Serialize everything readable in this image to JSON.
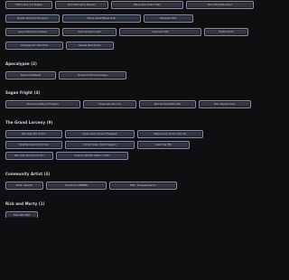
{
  "top_chips": [
    [
      "Ethnic Lina, Ara Rugiwe",
      "Nine Diad Ayme Pasuder",
      "Blauw Vaw Urabor Wlaa",
      "Moe Ahtia Ballo Glanl"
    ],
    [
      "Ppadan Wenavrd Pomapeer",
      "Wpow Cewat Bajeel Kmbr",
      "Blauzzsal Dvbr"
    ],
    [
      "Leonor Bea Rodri Lanbwa",
      "Auna Lanbwei Lvabll",
      "Kaxe Gerd Pelt",
      "Fiwstin Pmstr"
    ],
    [
      "Porbergoneh L Bord Pne",
      "Bebssa Beua Dmbu"
    ]
  ],
  "sections": [
    {
      "title": "Apocalypse (2)",
      "rows": [
        [
          "Djerved Kobbbeet",
          "Fyneprovt Dmmaa Haslgen"
        ]
      ]
    },
    {
      "title": "Sagan Fright (4)",
      "rows": [
        [
          "Sbaral Goerwtts (Q Hosgem)",
          "Fanee-vesn Binn (1)",
          "Wennet Pere BAVA Sd0)",
          "Bierr Nvereb Chern"
        ]
      ]
    },
    {
      "title": "The Grand Larceny (9)",
      "rows": [
        [
          "Rapi Wgx-Mol Uniforn",
          "Caeernvame (Hvernd Heelgwe)",
          "Nexennenrg Yaoorrr (Ve1.5e)"
        ],
        [
          "Bwdj Bemorenmmn Urrnel",
          "Cimdy Vwaan (Held Heelgen)",
          "Lxesh Fee (FR)"
        ],
        [
          "Beu Coler Mvverrnll Unifrn",
          "Anselnd Gemfdsr Mearnr Urrfen"
        ]
      ]
    },
    {
      "title": "Community Artist (3)",
      "rows": [
        [
          "Pmet - Pervem",
          "Nrosmnmm NMBMB",
          "BHX - Vhnseekomwnnn"
        ]
      ]
    },
    {
      "title": "Rick and Morty (1)",
      "rows": [
        [
          "Fiaen Mbr Wkb"
        ]
      ]
    }
  ]
}
